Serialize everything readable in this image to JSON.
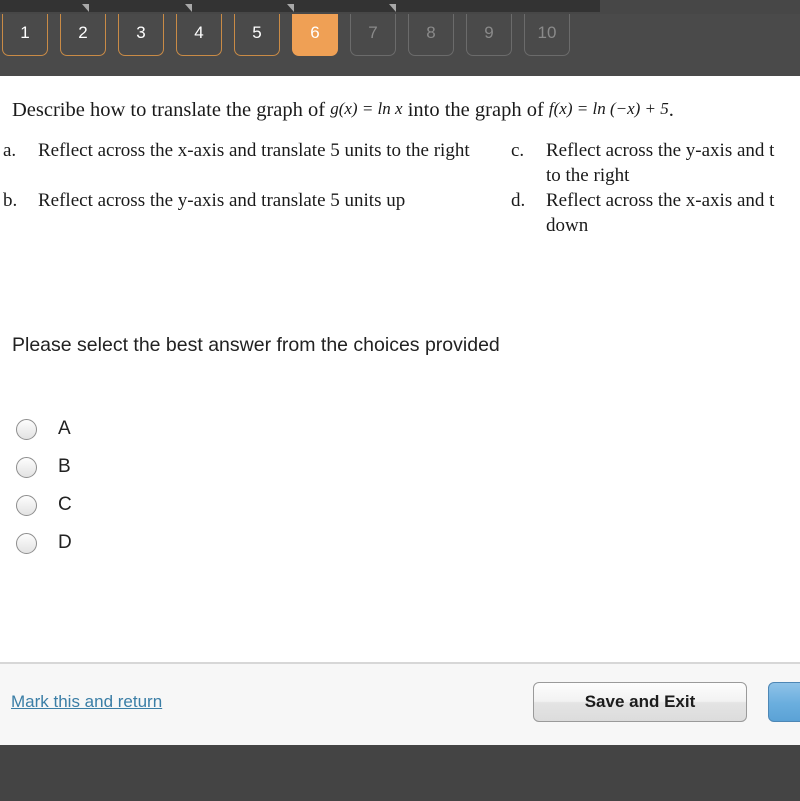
{
  "header": {
    "tabs": [
      {
        "label": "1",
        "state": "answered"
      },
      {
        "label": "2",
        "state": "answered"
      },
      {
        "label": "3",
        "state": "answered"
      },
      {
        "label": "4",
        "state": "answered"
      },
      {
        "label": "5",
        "state": "answered"
      },
      {
        "label": "6",
        "state": "current"
      },
      {
        "label": "7",
        "state": "locked"
      },
      {
        "label": "8",
        "state": "locked"
      },
      {
        "label": "9",
        "state": "locked"
      },
      {
        "label": "10",
        "state": "locked"
      }
    ],
    "active_color": "#efa055",
    "answered_border_color": "#c98b46",
    "locked_border_color": "#6b6b6b",
    "bar_color": "#4a4a4a"
  },
  "question": {
    "stem_part1": "Describe how to translate the graph of",
    "math1": "g(x) = ln x",
    "stem_part2": "into the graph of",
    "math2": "f(x) = ln (−x) + 5",
    "stem_end": ".",
    "choices": [
      {
        "letter": "a.",
        "text": "Reflect across the x-axis and translate 5 units to the right",
        "var": "x"
      },
      {
        "letter": "b.",
        "text": "Reflect across the y-axis and translate 5 units up",
        "var": "y"
      },
      {
        "letter": "c.",
        "text": "Reflect across the y-axis and t",
        "var": "y"
      },
      {
        "letter": "d.",
        "text": "Reflect across the x-axis and t",
        "var": "x"
      }
    ],
    "choice_c_line2": "to the right",
    "choice_d_line2": "down"
  },
  "instruction": "Please select the best answer from the choices provided",
  "options": [
    {
      "label": "A",
      "selected": false
    },
    {
      "label": "B",
      "selected": false
    },
    {
      "label": "C",
      "selected": false
    },
    {
      "label": "D",
      "selected": false
    }
  ],
  "footer": {
    "mark_link": "Mark this and return",
    "save_button": "Save and Exit",
    "next_button": "",
    "link_color": "#3b7ea6",
    "next_button_color": "#6aaede"
  }
}
